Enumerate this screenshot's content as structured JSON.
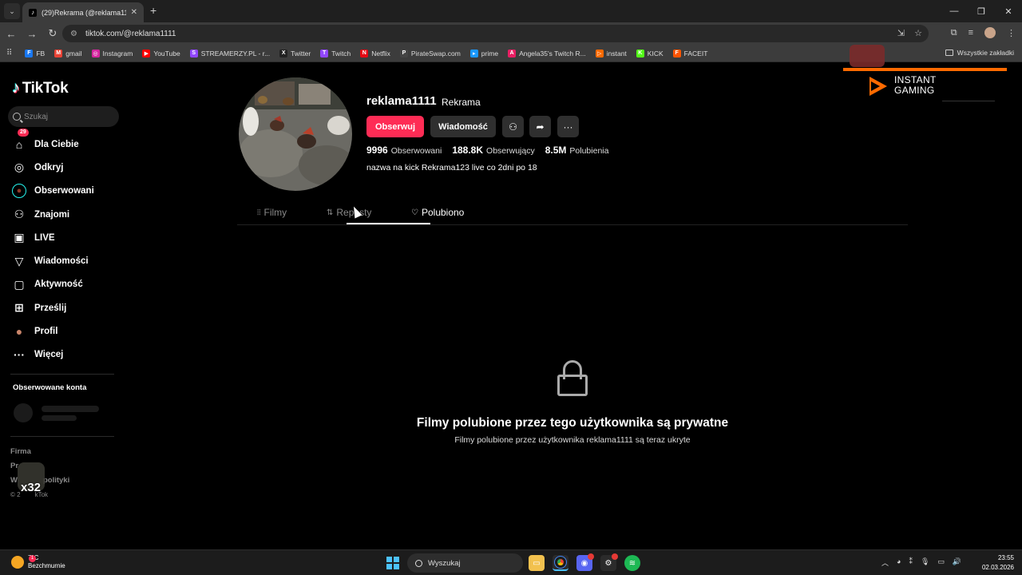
{
  "browser": {
    "tab_title": "(29)Rekrama (@reklama1111) |",
    "url": "tiktok.com/@reklama1111",
    "bookmarks": [
      {
        "label": "FB",
        "color": "#1877f2",
        "icon": "F"
      },
      {
        "label": "gmail",
        "color": "#ea4335",
        "icon": "M"
      },
      {
        "label": "Instagram",
        "color": "#d6249f",
        "icon": "◎"
      },
      {
        "label": "YouTube",
        "color": "#ff0000",
        "icon": "▶"
      },
      {
        "label": "STREAMERZY.PL - r...",
        "color": "#9146ff",
        "icon": "S"
      },
      {
        "label": "Twitter",
        "color": "#222222",
        "icon": "X"
      },
      {
        "label": "Twitch",
        "color": "#9146ff",
        "icon": "T"
      },
      {
        "label": "Netflix",
        "color": "#e50914",
        "icon": "N"
      },
      {
        "label": "PirateSwap.com",
        "color": "#444444",
        "icon": "P"
      },
      {
        "label": "prime",
        "color": "#1a98ff",
        "icon": "▸"
      },
      {
        "label": "Angela35's Twitch R...",
        "color": "#e91e63",
        "icon": "A"
      },
      {
        "label": "instant",
        "color": "#ff6a00",
        "icon": "▷"
      },
      {
        "label": "KICK",
        "color": "#53fc18",
        "icon": "K"
      },
      {
        "label": "FACEIT",
        "color": "#ff5500",
        "icon": "F"
      }
    ],
    "all_bookmarks": "Wszystkie zakładki"
  },
  "sidebar": {
    "logo": "TikTok",
    "search_placeholder": "Szukaj",
    "nav": [
      {
        "label": "Dla Ciebie",
        "icon": "home-icon",
        "glyph": "⌂"
      },
      {
        "label": "Odkryj",
        "icon": "compass-icon",
        "glyph": "◎"
      },
      {
        "label": "Obserwowani",
        "icon": "following-avatar-icon",
        "glyph": "●"
      },
      {
        "label": "Znajomi",
        "icon": "friends-icon",
        "glyph": "⚇"
      },
      {
        "label": "LIVE",
        "icon": "live-icon",
        "glyph": "▣"
      },
      {
        "label": "Wiadomości",
        "icon": "messages-icon",
        "glyph": "▽"
      },
      {
        "label": "Aktywność",
        "icon": "activity-icon",
        "glyph": "▢",
        "badge": "29"
      },
      {
        "label": "Prześlij",
        "icon": "upload-icon",
        "glyph": "⊞"
      },
      {
        "label": "Profil",
        "icon": "profile-avatar-icon",
        "glyph": "●"
      },
      {
        "label": "Więcej",
        "icon": "more-icon",
        "glyph": "···"
      }
    ],
    "followed_title": "Obserwowane konta",
    "footer": {
      "company": "Firma",
      "program": "Pr",
      "terms_prefix": "W",
      "terms_suffix": "polityki",
      "copyright_prefix": "© 2",
      "copyright_suffix": "kTok"
    },
    "overlay_number": "x32"
  },
  "profile": {
    "username": "reklama1111",
    "nickname": "Rekrama",
    "follow_label": "Obserwuj",
    "message_label": "Wiadomość",
    "stats": {
      "following_value": "9996",
      "following_label": "Obserwowani",
      "followers_value": "188.8K",
      "followers_label": "Obserwujący",
      "likes_value": "8.5M",
      "likes_label": "Polubienia"
    },
    "bio": "nazwa na kick Rekrama123 live co 2dni po 18",
    "tabs": {
      "films": "Filmy",
      "reposts": "Reposty",
      "liked": "Polubiono"
    },
    "private_title": "Filmy polubione przez tego użytkownika są prywatne",
    "private_subtitle": "Filmy polubione przez użytkownika reklama1111 są teraz ukryte"
  },
  "ad": {
    "line1": "INSTANT",
    "line2": "GAMING"
  },
  "taskbar": {
    "temperature": "7°C",
    "weather": "Bezchmurnie",
    "weather_badge": "1",
    "search_label": "Wyszukaj",
    "time": "23:55",
    "date": "02.03.2026"
  },
  "colors": {
    "accent": "#fe2c55",
    "background": "#000000"
  }
}
